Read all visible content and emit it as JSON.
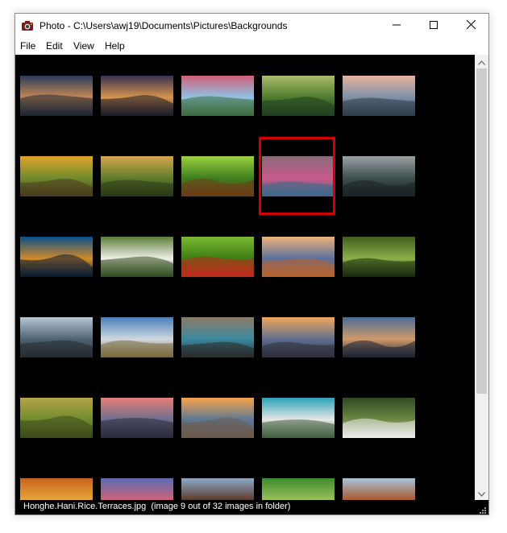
{
  "window": {
    "title": "Photo - C:\\Users\\awj19\\Documents\\Pictures\\Backgrounds"
  },
  "icons": {
    "app": "camera-icon",
    "minimize": "minimize-icon",
    "maximize": "maximize-icon",
    "close": "close-icon",
    "scroll_up": "chevron-up-icon",
    "scroll_down": "chevron-down-icon",
    "size_grip": "size-grip-icon"
  },
  "menu": {
    "file": "File",
    "edit": "Edit",
    "view": "View",
    "help": "Help"
  },
  "thumbnails": [
    {
      "colors": [
        "#2a3b5c",
        "#c68a55",
        "#1b2433"
      ]
    },
    {
      "colors": [
        "#3a3050",
        "#d9964d",
        "#1a1a2a"
      ]
    },
    {
      "colors": [
        "#d25f7a",
        "#8fc4e6",
        "#3c6b3a"
      ]
    },
    {
      "colors": [
        "#a9bd6a",
        "#4f7a2e",
        "#1f3f22"
      ]
    },
    {
      "colors": [
        "#e8b4a0",
        "#7b8fa8",
        "#2f3d4a"
      ]
    },
    {
      "colors": [
        "#e0a528",
        "#6f8a2d",
        "#4a3c1e"
      ]
    },
    {
      "colors": [
        "#d6a64f",
        "#5e7d2b",
        "#2b3a17"
      ]
    },
    {
      "colors": [
        "#9bd141",
        "#3e7f1f",
        "#6d3a16"
      ]
    },
    {
      "colors": [
        "#8a6a7a",
        "#c95a8a",
        "#3a6a8a"
      ]
    },
    {
      "colors": [
        "#9aa1a3",
        "#3e4e4f",
        "#1a2224"
      ]
    },
    {
      "colors": [
        "#0b4f8a",
        "#d28a2a",
        "#051a33"
      ]
    },
    {
      "colors": [
        "#5c7e3b",
        "#f0f0ea",
        "#2f4a1c"
      ]
    },
    {
      "colors": [
        "#7ab931",
        "#3d7d14",
        "#c3281c"
      ]
    },
    {
      "colors": [
        "#efb27a",
        "#5a6f9c",
        "#b8642e"
      ]
    },
    {
      "colors": [
        "#3f5e1f",
        "#8cb048",
        "#1a2a0c"
      ]
    },
    {
      "colors": [
        "#b7c7d6",
        "#4e6372",
        "#242c30"
      ]
    },
    {
      "colors": [
        "#4a7eb9",
        "#cfd8e0",
        "#7a6a3a"
      ]
    },
    {
      "colors": [
        "#8d7a66",
        "#3a8aa0",
        "#2a2a2a"
      ]
    },
    {
      "colors": [
        "#f2a65a",
        "#5f6f8f",
        "#2b2f3c"
      ]
    },
    {
      "colors": [
        "#4a6c96",
        "#d09a6a",
        "#1a2235"
      ]
    },
    {
      "colors": [
        "#b7a347",
        "#6f8b2f",
        "#3c4a1c"
      ]
    },
    {
      "colors": [
        "#e87e78",
        "#6d6f8f",
        "#2a2a3a"
      ]
    },
    {
      "colors": [
        "#f7a34c",
        "#5c7894",
        "#6b5a4a"
      ]
    },
    {
      "colors": [
        "#2aa1b7",
        "#e8e8e8",
        "#3f5e3e"
      ]
    },
    {
      "colors": [
        "#2f4a23",
        "#6c8a44",
        "#ededed"
      ]
    },
    {
      "colors": [
        "#c8621f",
        "#e7a83a",
        "#4a2c14"
      ]
    },
    {
      "colors": [
        "#5a6ab0",
        "#d0627a",
        "#ededf0"
      ]
    },
    {
      "colors": [
        "#8fa8c7",
        "#5a3a2a",
        "#d6a270"
      ]
    },
    {
      "colors": [
        "#3d8a2f",
        "#9cc35a",
        "#1e3a14"
      ]
    },
    {
      "colors": [
        "#a9c3d8",
        "#a8562a",
        "#3a3a3a"
      ]
    }
  ],
  "status": {
    "filename": "Honghe.Hani.Rice.Terraces.jpg",
    "info": "(image 9 out of 32 images in folder)"
  }
}
